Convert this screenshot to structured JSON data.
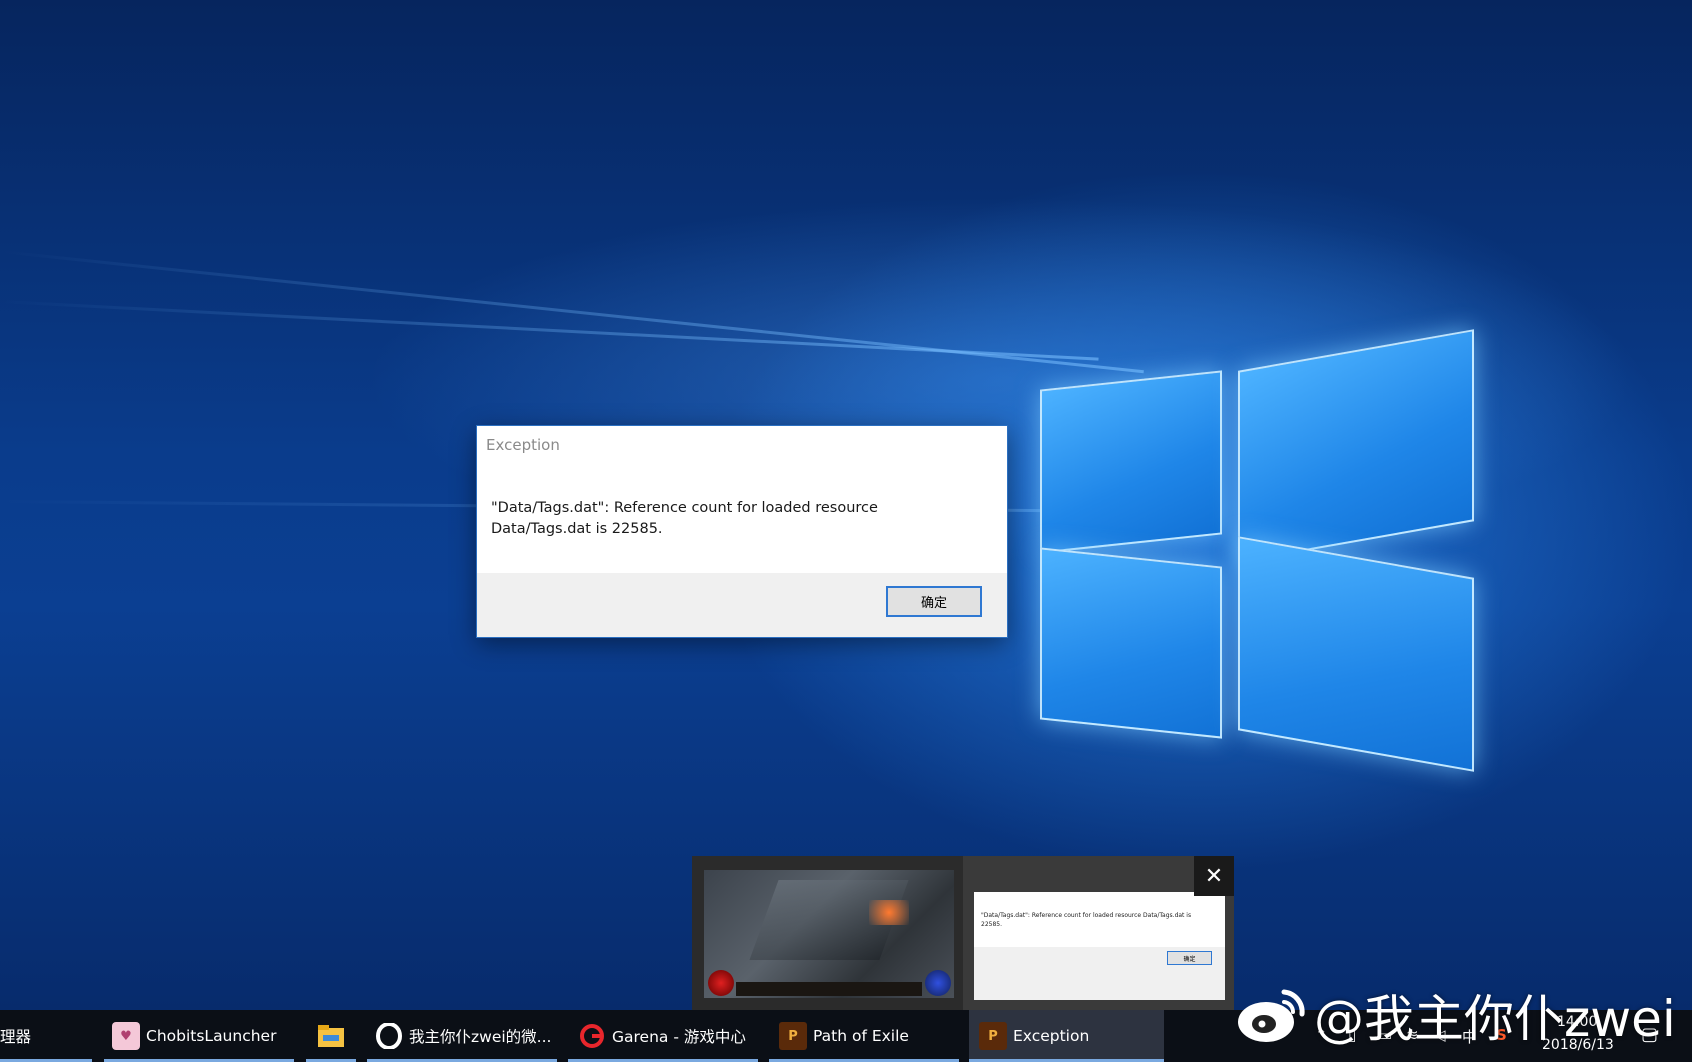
{
  "dialog": {
    "title": "Exception",
    "message": "\"Data/Tags.dat\": Reference count for loaded resource Data/Tags.dat is 22585.",
    "ok_label": "确定"
  },
  "thumbnail_popup": {
    "message": "\"Data/Tags.dat\": Reference count for loaded resource Data/Tags.dat is 22585.",
    "ok_label": "确定",
    "close_icon": "close-icon"
  },
  "taskbar": {
    "items": [
      {
        "label": "理器",
        "icon": "app-icon"
      },
      {
        "label": "ChobitsLauncher",
        "icon": "chobits-icon"
      },
      {
        "label": "",
        "icon": "file-explorer-icon"
      },
      {
        "label": "我主你仆zwei的微...",
        "icon": "opera-icon"
      },
      {
        "label": "Garena - 游戏中心",
        "icon": "garena-icon"
      },
      {
        "label": "Path of Exile",
        "icon": "poe-icon"
      },
      {
        "label": "Exception",
        "icon": "poe-icon"
      }
    ],
    "clock": {
      "time": "14:00",
      "date": "2018/6/13"
    }
  },
  "watermark": {
    "text": "@我主你仆zwei"
  },
  "colors": {
    "accent": "#2f78d2",
    "taskbar": "#0b0f16",
    "desktop": "#0a3c8c"
  }
}
